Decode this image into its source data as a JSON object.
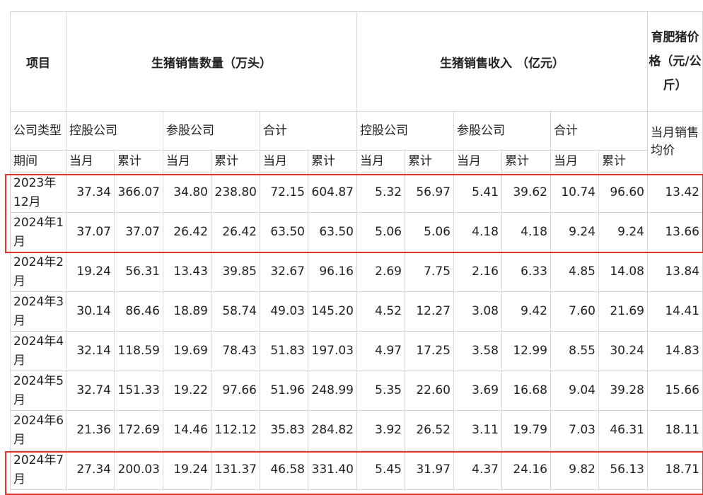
{
  "headers": {
    "item": "项目",
    "quantity_group": "生猪销售数量（万头）",
    "revenue_group": "生猪销售收入 （亿元）",
    "price_group": "育肥猪价格（元/公斤）",
    "company_type": "公司类型",
    "holding": "控股公司",
    "participating": "参股公司",
    "total": "合计",
    "period": "期间",
    "current_month": "当月",
    "cumulative": "累计",
    "avg_price": "当月销售均价"
  },
  "rows": [
    {
      "period": "2023年12月",
      "values": [
        "37.34",
        "366.07",
        "34.80",
        "238.80",
        "72.15",
        "604.87",
        "5.32",
        "56.97",
        "5.41",
        "39.62",
        "10.74",
        "96.60",
        "13.42"
      ]
    },
    {
      "period": "2024年1月",
      "values": [
        "37.07",
        "37.07",
        "26.42",
        "26.42",
        "63.50",
        "63.50",
        "5.06",
        "5.06",
        "4.18",
        "4.18",
        "9.24",
        "9.24",
        "13.66"
      ]
    },
    {
      "period": "2024年2月",
      "values": [
        "19.24",
        "56.31",
        "13.43",
        "39.85",
        "32.67",
        "96.16",
        "2.69",
        "7.75",
        "2.16",
        "6.33",
        "4.85",
        "14.08",
        "13.84"
      ]
    },
    {
      "period": "2024年3月",
      "values": [
        "30.14",
        "86.46",
        "18.89",
        "58.74",
        "49.03",
        "145.20",
        "4.52",
        "12.27",
        "3.08",
        "9.42",
        "7.60",
        "21.69",
        "14.41"
      ]
    },
    {
      "period": "2024年4月",
      "values": [
        "32.14",
        "118.59",
        "19.69",
        "78.43",
        "51.83",
        "197.03",
        "4.97",
        "17.25",
        "3.58",
        "12.99",
        "8.55",
        "30.24",
        "14.83"
      ]
    },
    {
      "period": "2024年5月",
      "values": [
        "32.74",
        "151.33",
        "19.22",
        "97.66",
        "51.96",
        "248.99",
        "5.35",
        "22.60",
        "3.69",
        "16.68",
        "9.04",
        "39.28",
        "15.66"
      ]
    },
    {
      "period": "2024年6月",
      "values": [
        "21.36",
        "172.69",
        "14.46",
        "112.12",
        "35.83",
        "284.82",
        "3.92",
        "26.52",
        "3.11",
        "19.79",
        "7.03",
        "46.31",
        "18.11"
      ]
    },
    {
      "period": "2024年7月",
      "values": [
        "27.34",
        "200.03",
        "19.24",
        "131.37",
        "46.58",
        "331.40",
        "5.45",
        "31.97",
        "4.37",
        "24.16",
        "9.82",
        "56.13",
        "18.71"
      ]
    }
  ],
  "highlight_color": "#e8312a"
}
